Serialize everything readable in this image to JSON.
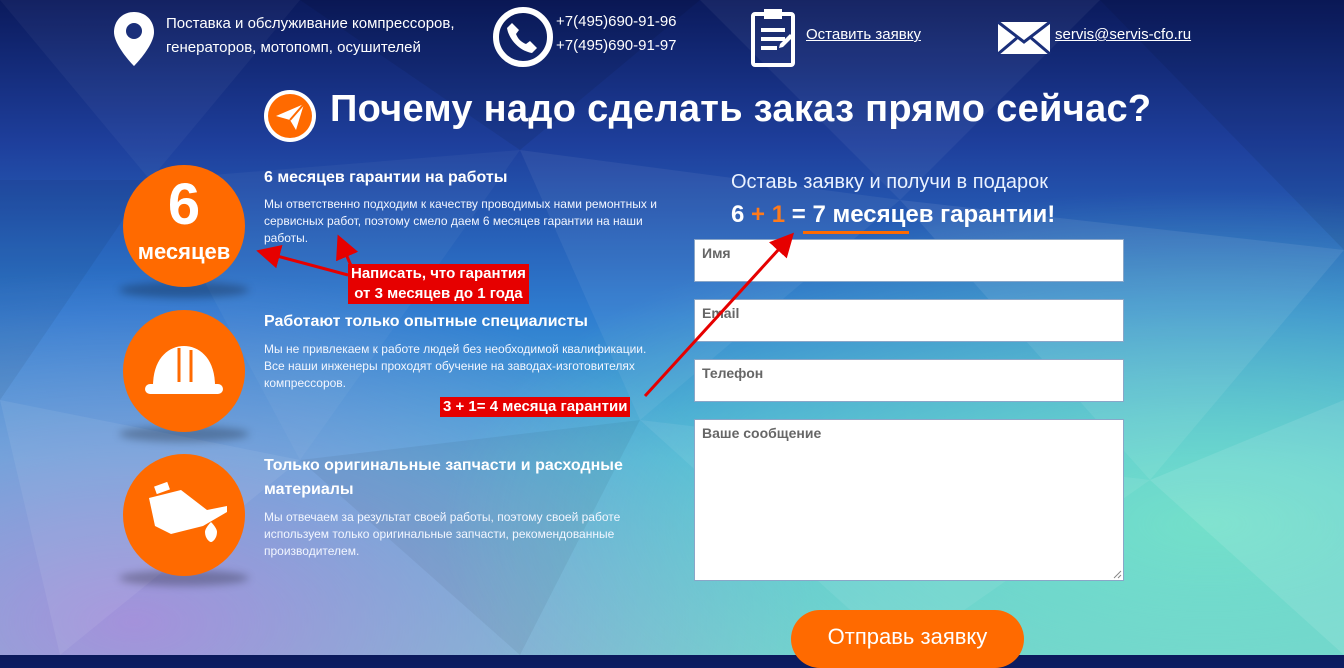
{
  "header": {
    "services_line1": "Поставка и обслуживание компрессоров,",
    "services_line2": "генераторов, мотопомп, осушителей",
    "phone1": "+7(495)690-91-96",
    "phone2": "+7(495)690-91-97",
    "request_link": "Оставить заявку",
    "email": "servis@servis-cfo.ru"
  },
  "heading": "Почему надо сделать заказ прямо сейчас?",
  "features": [
    {
      "badge_number": "6",
      "badge_label": "месяцев",
      "title": "6 месяцев гарантии на работы",
      "text": "Мы ответственно подходим к качеству проводимых нами ремонтных и сервисных работ, поэтому смело даем 6 месяцев гарантии на наши работы."
    },
    {
      "title": "Работают только опытные специалисты",
      "text": "Мы не привлекаем к работе людей без необходимой квалификации. Все наши инженеры проходят обучение на заводах-изготовителях компрессоров."
    },
    {
      "title": "Только оригинальные запчасти и расходные материалы",
      "text": "Мы отвечаем за результат своей работы, поэтому своей работе используем только оригинальные запчасти, рекомендованные производителем."
    }
  ],
  "form": {
    "promo_line1": "Оставь заявку и получи в подарок",
    "promo_a": "6",
    "promo_plus": "+",
    "promo_b": "1",
    "promo_eq": "=",
    "promo_result": "7 месяцев гарантии!",
    "name_placeholder": "Имя",
    "email_placeholder": "Email",
    "phone_placeholder": "Телефон",
    "message_placeholder": "Ваше сообщение",
    "submit_label": "Отправь заявку"
  },
  "annotations": {
    "note1_line1": "Написать, что гарантия",
    "note1_line2": "от 3 месяцев до 1 года",
    "note2": "3 + 1= 4 месяца гарантии"
  },
  "colors": {
    "accent": "#ff6a00",
    "annotation": "#e60000"
  }
}
